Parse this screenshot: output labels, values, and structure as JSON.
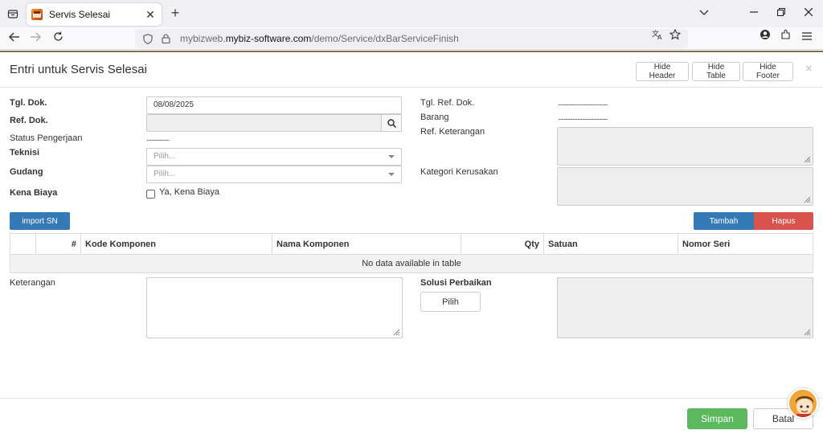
{
  "browser": {
    "tab_title": "Servis Selesai",
    "url_prefix": "mybizweb.",
    "url_domain": "mybiz-software.com",
    "url_path": "/demo/Service/dxBarServiceFinish"
  },
  "modal": {
    "title": "Entri untuk Servis Selesai",
    "hide_header": "Hide Header",
    "hide_table": "Hide Table",
    "hide_footer": "Hide Footer",
    "close": "×"
  },
  "form": {
    "tgl_dok_label": "Tgl. Dok.",
    "tgl_dok_value": "08/08/2025",
    "ref_dok_label": "Ref. Dok.",
    "status_label": "Status Pengerjaan",
    "status_value": "...................",
    "teknisi_label": "Teknisi",
    "teknisi_placeholder": "Pilih...",
    "gudang_label": "Gudang",
    "gudang_placeholder": "Pilih...",
    "kena_biaya_label": "Kena Biaya",
    "kena_biaya_checkbox": "Ya, Kena Biaya",
    "tgl_ref_label": "Tgl. Ref. Dok.",
    "tgl_ref_value": ".........................................",
    "barang_label": "Barang",
    "barang_value": ".........................................",
    "ref_keterangan_label": "Ref. Keterangan",
    "kategori_label": "Kategori Kerusakan",
    "keterangan_label": "Keterangan",
    "solusi_label": "Solusi Perbaikan",
    "pilih_button": "Pilih"
  },
  "actions": {
    "import_sn": "import SN",
    "tambah": "Tambah",
    "hapus": "Hapus",
    "simpan": "Simpan",
    "batal": "Batal"
  },
  "table": {
    "columns": [
      "",
      "#",
      "Kode Komponen",
      "Nama Komponen",
      "Qty",
      "Satuan",
      "Nomor Seri"
    ],
    "empty_message": "No data available in table"
  },
  "colors": {
    "primary": "#337ab7",
    "danger": "#d9534f",
    "success": "#5cb85c"
  }
}
